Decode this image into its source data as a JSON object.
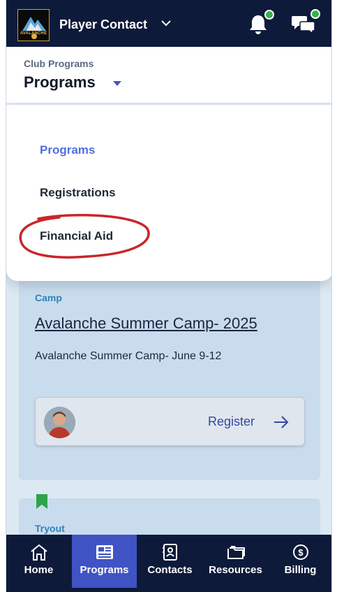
{
  "header": {
    "title": "Player Contact",
    "logo_lettering": "AVALANCHE",
    "icons": [
      "chevron-down-icon",
      "bell-icon",
      "chat-icon"
    ],
    "notification_dot_color": "#35b14e"
  },
  "subheader": {
    "small_label": "Club Programs",
    "big_label": "Programs"
  },
  "dropdown": {
    "items": [
      {
        "label": "Programs",
        "active": true
      },
      {
        "label": "Registrations",
        "active": false
      },
      {
        "label": "Financial Aid",
        "active": false,
        "annotated": true
      }
    ],
    "annotation_color": "#c8262c"
  },
  "card": {
    "tag": "Camp",
    "title": "Avalanche Summer Camp- 2025",
    "description": "Avalanche Summer Camp- June 9-12",
    "register_label": "Register"
  },
  "card2": {
    "tag": "Tryout"
  },
  "bottom_nav": {
    "items": [
      {
        "label": "Home",
        "icon": "home-icon",
        "active": false
      },
      {
        "label": "Programs",
        "icon": "programs-icon",
        "active": true
      },
      {
        "label": "Contacts",
        "icon": "contacts-icon",
        "active": false
      },
      {
        "label": "Resources",
        "icon": "folder-icon",
        "active": false
      },
      {
        "label": "Billing",
        "icon": "billing-icon",
        "active": false
      }
    ]
  },
  "colors": {
    "header_bg": "#0e1a3a",
    "accent": "#3f53c4",
    "active_link": "#4f6fe0"
  }
}
